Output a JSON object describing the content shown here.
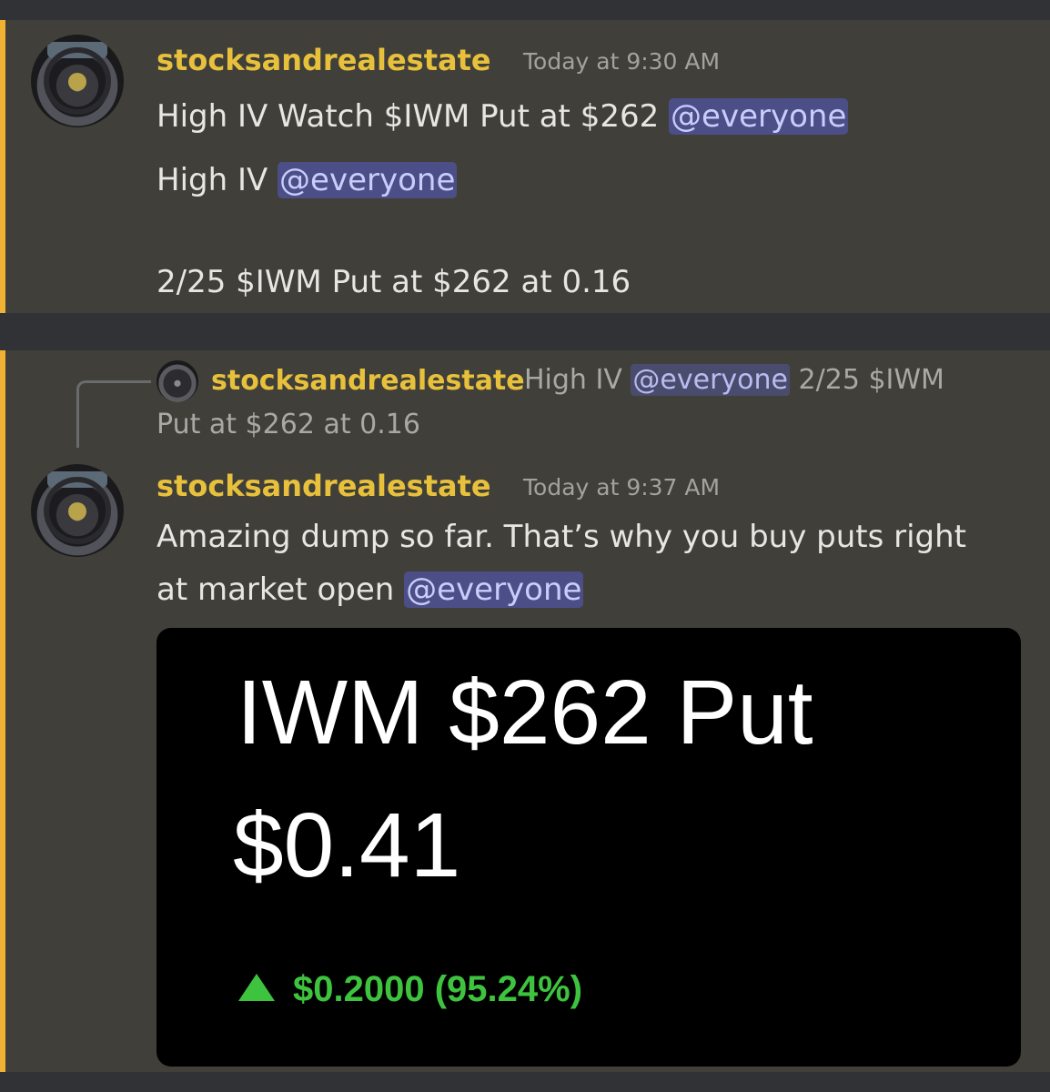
{
  "messages": [
    {
      "username": "stocksandrealestate",
      "timestamp": "Today at 9:30 AM",
      "line1": "High IV Watch $IWM Put at $262 ",
      "line1_mention": "@everyone",
      "line2": "High IV ",
      "line2_mention": "@everyone",
      "line3": "2/25 $IWM Put at $262 at 0.16"
    },
    {
      "reply": {
        "username": "stocksandrealestate",
        "text_before": "High IV ",
        "mention": "@everyone",
        "text_after": " 2/25 $IWM",
        "text_line2": "Put at $262 at 0.16"
      },
      "username": "stocksandrealestate",
      "timestamp": "Today at 9:37 AM",
      "line1": "Amazing dump so far. That’s why you buy puts right",
      "line2": "at market open ",
      "line2_mention": "@everyone",
      "card": {
        "title": "IWM $262 Put",
        "price": "$0.41",
        "change": "$0.2000 (95.24%)",
        "change_direction": "up",
        "change_color": "#3ec33f"
      }
    }
  ],
  "colors": {
    "accent_bar": "#f0b232",
    "username": "#e8c13c",
    "mention_bg": "#4c4f87",
    "mention_text": "#c9cdfb"
  }
}
